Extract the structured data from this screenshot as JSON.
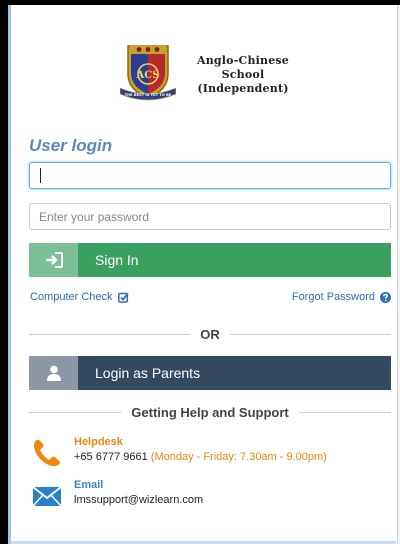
{
  "brand": {
    "school_line1": "Anglo-Chinese School",
    "school_line2": "(Independent)",
    "motto": "THE BEST IS YET TO BE",
    "crest_initials": "ACS"
  },
  "login": {
    "title": "User login",
    "username_value": "",
    "password_placeholder": "Enter your password",
    "signin_label": "Sign In",
    "computer_check_label": "Computer Check",
    "forgot_password_label": "Forgot Password",
    "or_label": "OR",
    "parents_label": "Login as Parents"
  },
  "support": {
    "heading": "Getting Help and Support",
    "helpdesk": {
      "title": "Helpdesk",
      "phone": "+65 6777 9661",
      "hours": "(Monday - Friday: 7.30am - 9.00pm)"
    },
    "email": {
      "title": "Email",
      "address": "lmssupport@wizlearn.com"
    }
  },
  "icons": {
    "signin": "sign-in-icon",
    "computer_check": "check-square-icon",
    "forgot_password": "question-circle-icon",
    "parents": "user-icon",
    "helpdesk": "phone-icon",
    "email": "envelope-icon"
  },
  "colors": {
    "accent_blue": "#5b86c4",
    "signin_green": "#3aa061",
    "parents_navy": "#34495e",
    "helpdesk_orange": "#e8890c",
    "email_blue": "#3b86c9"
  }
}
